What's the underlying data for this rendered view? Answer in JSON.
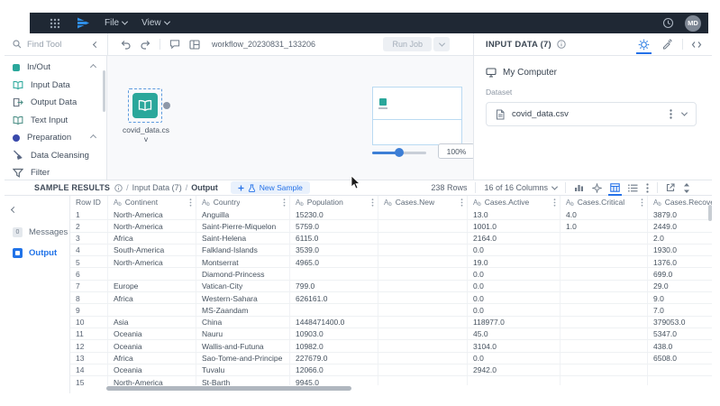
{
  "topbar": {
    "menus": [
      {
        "label": "File"
      },
      {
        "label": "View"
      }
    ],
    "avatar_initials": "MD"
  },
  "tool_sidebar": {
    "search_placeholder": "Find Tool",
    "items": [
      {
        "label": "In/Out",
        "type": "category"
      },
      {
        "label": "Input Data",
        "type": "tool"
      },
      {
        "label": "Output Data",
        "type": "tool"
      },
      {
        "label": "Text Input",
        "type": "tool"
      },
      {
        "label": "Preparation",
        "type": "category"
      },
      {
        "label": "Data Cleansing",
        "type": "tool"
      },
      {
        "label": "Filter",
        "type": "tool"
      }
    ]
  },
  "canvas": {
    "title": "workflow_20230831_133206",
    "run_job_label": "Run Job",
    "node_label_line1": "covid_data.cs",
    "node_label_line2": "v",
    "zoom_value": "100%"
  },
  "input_panel": {
    "title": "INPUT DATA (7)",
    "source": "My Computer",
    "dataset_label": "Dataset",
    "file_name": "covid_data.csv"
  },
  "results": {
    "title": "SAMPLE RESULTS",
    "breadcrumb_separator": "/",
    "breadcrumb_input": "Input Data (7)",
    "breadcrumb_output": "Output",
    "new_sample_label": "New Sample",
    "rows_count": "238 Rows",
    "columns_count": "16 of 16 Columns",
    "tabs": [
      {
        "label": "Messages",
        "badge": "0"
      },
      {
        "label": "Output"
      }
    ],
    "table": {
      "row_id_header": "Row ID",
      "type_glyph": {
        "main": "A",
        "sub": "b"
      },
      "columns": [
        "Continent",
        "Country",
        "Population",
        "Cases.New",
        "Cases.Active",
        "Cases.Critical",
        "Cases.Recovered"
      ],
      "rows": [
        {
          "id": "1",
          "cells": [
            "North-America",
            "Anguilla",
            "15230.0",
            "",
            "13.0",
            "4.0",
            "3879.0"
          ]
        },
        {
          "id": "2",
          "cells": [
            "North-America",
            "Saint-Pierre-Miquelon",
            "5759.0",
            "",
            "1001.0",
            "1.0",
            "2449.0"
          ]
        },
        {
          "id": "3",
          "cells": [
            "Africa",
            "Saint-Helena",
            "6115.0",
            "",
            "2164.0",
            "",
            "2.0"
          ]
        },
        {
          "id": "4",
          "cells": [
            "South-America",
            "Falkland-Islands",
            "3539.0",
            "",
            "0.0",
            "",
            "1930.0"
          ]
        },
        {
          "id": "5",
          "cells": [
            "North-America",
            "Montserrat",
            "4965.0",
            "",
            "19.0",
            "",
            "1376.0"
          ]
        },
        {
          "id": "6",
          "cells": [
            "",
            "Diamond-Princess",
            "",
            "",
            "0.0",
            "",
            "699.0"
          ]
        },
        {
          "id": "7",
          "cells": [
            "Europe",
            "Vatican-City",
            "799.0",
            "",
            "0.0",
            "",
            "29.0"
          ]
        },
        {
          "id": "8",
          "cells": [
            "Africa",
            "Western-Sahara",
            "626161.0",
            "",
            "0.0",
            "",
            "9.0"
          ]
        },
        {
          "id": "9",
          "cells": [
            "",
            "MS-Zaandam",
            "",
            "",
            "0.0",
            "",
            "7.0"
          ]
        },
        {
          "id": "10",
          "cells": [
            "Asia",
            "China",
            "1448471400.0",
            "",
            "118977.0",
            "",
            "379053.0"
          ]
        },
        {
          "id": "11",
          "cells": [
            "Oceania",
            "Nauru",
            "10903.0",
            "",
            "45.0",
            "",
            "5347.0"
          ]
        },
        {
          "id": "12",
          "cells": [
            "Oceania",
            "Wallis-and-Futuna",
            "10982.0",
            "",
            "3104.0",
            "",
            "438.0"
          ]
        },
        {
          "id": "13",
          "cells": [
            "Africa",
            "Sao-Tome-and-Principe",
            "227679.0",
            "",
            "0.0",
            "",
            "6508.0"
          ]
        },
        {
          "id": "14",
          "cells": [
            "Oceania",
            "Tuvalu",
            "12066.0",
            "",
            "2942.0",
            "",
            ""
          ]
        },
        {
          "id": "15",
          "cells": [
            "North-America",
            "St-Barth",
            "9945.0",
            "",
            "",
            "",
            ""
          ]
        }
      ]
    }
  },
  "colors": {
    "accent": "#2173e8",
    "teal": "#2aa79b",
    "topbar": "#1f2834"
  }
}
